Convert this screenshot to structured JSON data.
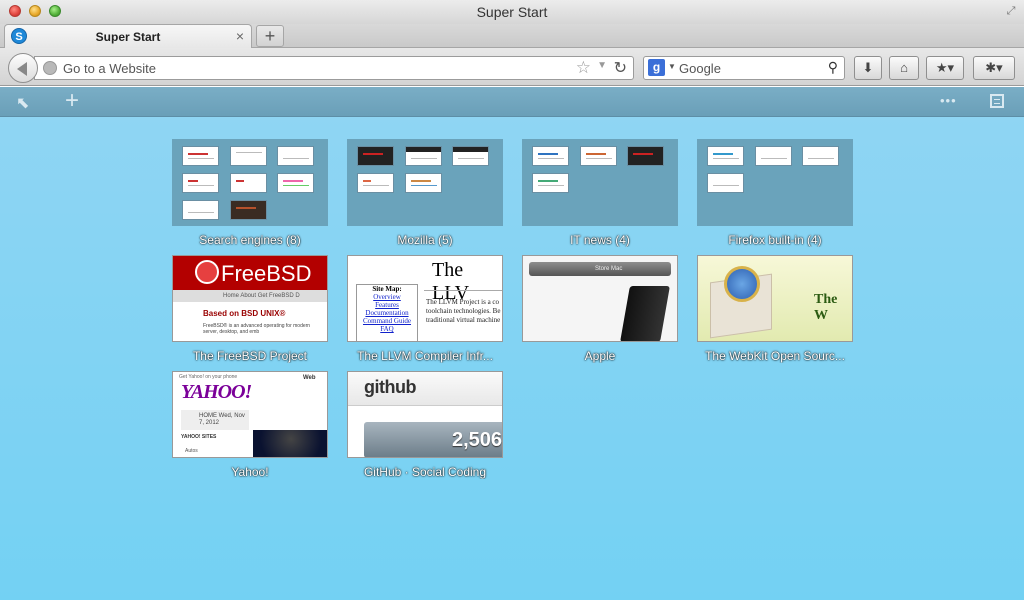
{
  "window": {
    "title": "Super Start"
  },
  "tab": {
    "title": "Super Start",
    "close_label": "×",
    "favicon_letter": "S"
  },
  "new_tab_label": "+",
  "urlbar": {
    "placeholder": "Go to a Website"
  },
  "searchbar": {
    "placeholder": "Google",
    "engine_letter": "g"
  },
  "toolbar": {
    "add_label": "+",
    "more_label": "•••"
  },
  "folders": [
    {
      "label": "Search engines (8)"
    },
    {
      "label": "Mozilla (5)"
    },
    {
      "label": "IT news (4)"
    },
    {
      "label": "Firefox built-in (4)"
    }
  ],
  "sites": [
    {
      "label": "The FreeBSD Project"
    },
    {
      "label": "The LLVM Compiler Infr..."
    },
    {
      "label": "Apple"
    },
    {
      "label": "The WebKit Open Sourc..."
    },
    {
      "label": "Yahoo!"
    },
    {
      "label": "GitHub · Social Coding"
    }
  ],
  "thumbs": {
    "freebsd": {
      "logo": "FreeBSD",
      "nav": "Home  About  Get FreeBSD  D",
      "based": "Based on BSD UNIX®",
      "desc": "FreeBSD® is an advanced operating for modern server, desktop, and emb"
    },
    "llvm": {
      "title": "The LLV",
      "sitemap": "Site Map:",
      "links": [
        "Overview",
        "Features",
        "Documentation",
        "Command Guide",
        "FAQ"
      ],
      "desc": "The LLVM Project is a co toolchain technologies. Be traditional virtual machine"
    },
    "apple": {
      "nav": "Store        Mac"
    },
    "webkit": {
      "text": "The W"
    },
    "yahoo": {
      "tagline": "Get Yahoo! on your phone",
      "logo": "YAHOO!",
      "web": "Web",
      "home": "HOME Wed, Nov 7, 2012",
      "sites": "YAHOO! SITES",
      "autos": "Autos"
    },
    "github": {
      "logo": "github",
      "count": "2,506"
    }
  },
  "colors": {
    "content_top": "#8fd5f3",
    "content_bottom": "#73d1f3",
    "folder_bg": "#6aa3bb",
    "toolbar": "#7aaec6"
  }
}
